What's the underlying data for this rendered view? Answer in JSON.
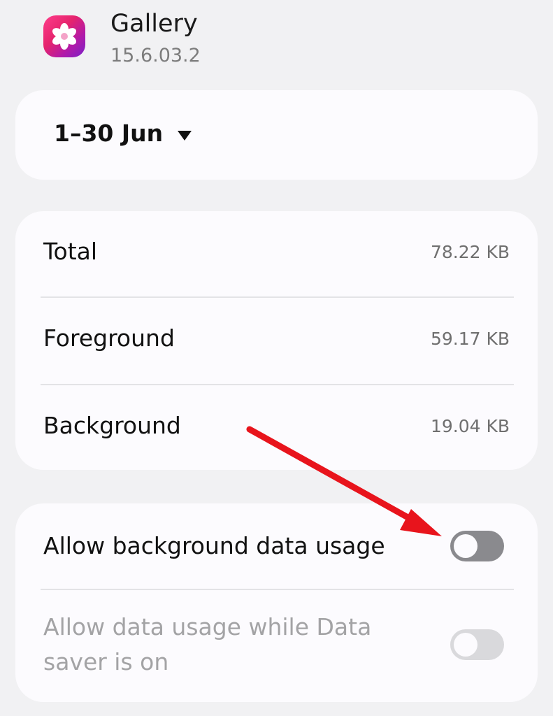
{
  "app": {
    "name": "Gallery",
    "version": "15.6.03.2",
    "icon": "gallery-flower-icon"
  },
  "period": {
    "label": "1–30 Jun",
    "icon": "dropdown-triangle-icon"
  },
  "usage": {
    "rows": [
      {
        "label": "Total",
        "value": "78.22 KB"
      },
      {
        "label": "Foreground",
        "value": "59.17 KB"
      },
      {
        "label": "Background",
        "value": "19.04 KB"
      }
    ]
  },
  "settings": {
    "background_data": {
      "label": "Allow background data usage",
      "enabled": false
    },
    "data_saver": {
      "label": "Allow data usage while Data saver is on",
      "enabled": false,
      "disabled": true
    }
  },
  "colors": {
    "background": "#f1f1f3",
    "card": "#fcfbfe",
    "toggle_off": "#8a8a8e",
    "toggle_disabled": "#d9d9dc",
    "annotation_arrow": "#e8141c"
  }
}
